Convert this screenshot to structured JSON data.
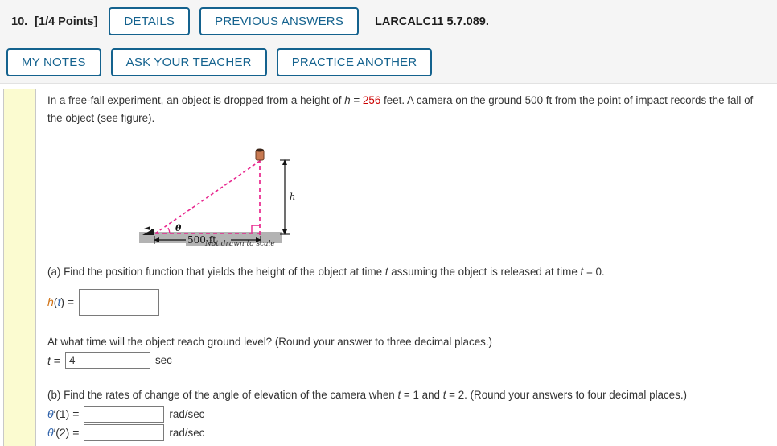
{
  "header": {
    "question_number": "10.",
    "points": "[1/4 Points]",
    "buttons_row1": [
      {
        "label": "DETAILS",
        "name": "details-button"
      },
      {
        "label": "PREVIOUS ANSWERS",
        "name": "previous-answers-button"
      }
    ],
    "textbook_ref": "LARCALC11 5.7.089.",
    "buttons_row2": [
      {
        "label": "MY NOTES",
        "name": "my-notes-button"
      },
      {
        "label": "ASK YOUR TEACHER",
        "name": "ask-your-teacher-button"
      },
      {
        "label": "PRACTICE ANOTHER",
        "name": "practice-another-button"
      }
    ],
    "accent_color": "#14628e"
  },
  "problem": {
    "line1_a": "In a free-fall experiment, an object is dropped from a height of ",
    "line1_h": "h",
    "line1_eq": " = ",
    "line1_value": "256",
    "line1_b": " feet. A camera on the ground 500 ft from the point of impact recordsp the fall of the object (see figure).",
    "line1_b_real": " feet. A camera on the ground 500 ft from the point of impact records the fall of the object (see figure)."
  },
  "figure": {
    "angle_label": "θ",
    "base_label": "500 ft",
    "height_label": "h",
    "note": "Not drawn to scale",
    "line_color": "#e8268e",
    "ground_color": "#b3b3b3",
    "object_color": "#c87a52"
  },
  "part_a": {
    "prompt_pre": "(a) Find the position function that yields the height of the object at time ",
    "prompt_t1": "t",
    "prompt_mid": " assuming the object is released at time ",
    "prompt_t2": "t",
    "prompt_post": " = 0.",
    "label_h": "h",
    "label_paren_open": "(",
    "label_t": "t",
    "label_paren_close": ") = ",
    "input_value": "",
    "input_placeholder": ""
  },
  "part_a2": {
    "prompt": "At what time will the object reach ground level? (Round your answer to three decimal places.)",
    "label_t": "t",
    "label_eq": " = ",
    "input_value": "4",
    "unit": "sec"
  },
  "part_b": {
    "prompt_pre": "(b) Find the rates of change of the angle of elevation of the camera when ",
    "prompt_t1": "t",
    "prompt_mid1": " = 1 and ",
    "prompt_t2": "t",
    "prompt_post": " = 2. (Round your answers to four decimal places.)",
    "rows": [
      {
        "label_theta": "θ",
        "label_rest": "′(1) = ",
        "value": "",
        "unit": "rad/sec"
      },
      {
        "label_theta": "θ",
        "label_rest": "′(2) = ",
        "value": "",
        "unit": "rad/sec"
      }
    ]
  }
}
